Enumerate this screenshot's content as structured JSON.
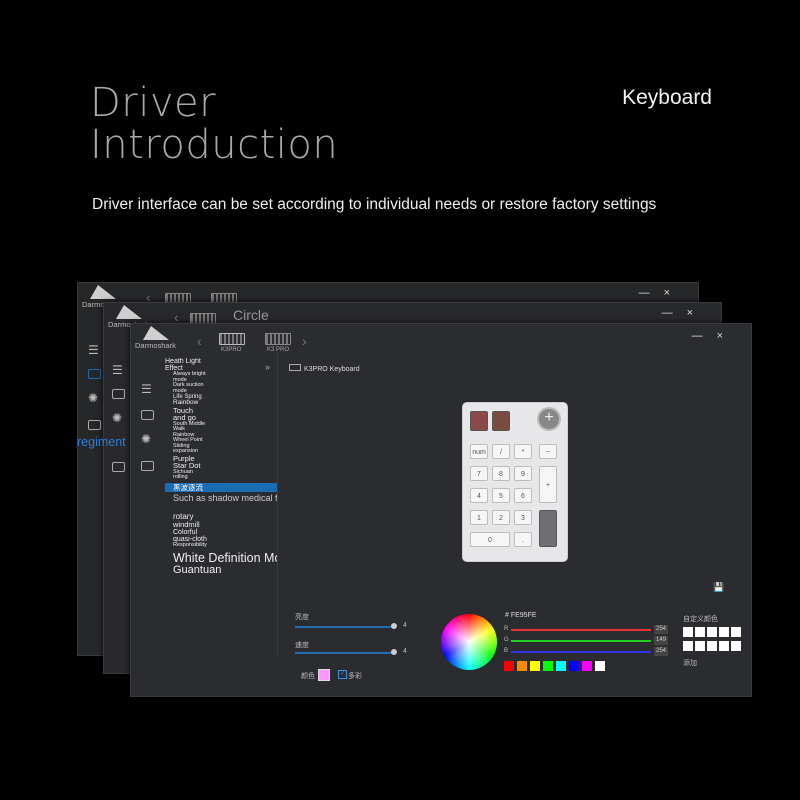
{
  "hero": {
    "title_line1": "Driver",
    "title_line2": "Introduction",
    "tag": "Keyboard",
    "subtitle": "Driver interface can be set according to individual needs or restore factory settings"
  },
  "colors": {
    "selection": "#1a6cb3",
    "slider": "#1e6db0",
    "background": "#000000"
  },
  "back_windows": {
    "w1_brand": "Darmoshark",
    "w2_brand": "Darmoshark",
    "w2_mode_title": "Circle",
    "w2_side_overlay": "regiment"
  },
  "window": {
    "brand": "Darmoshark",
    "minimize": "—",
    "close": "×",
    "devices": [
      "K3PRO",
      "K3 PRO"
    ],
    "panel_title": "K3PRO Keyboard",
    "light_list": [
      "Heath Light",
      "Effect",
      "Always bright",
      "mode",
      "Dark suction",
      "mode",
      "Life Spring",
      "Rainbow",
      "Touch",
      "and go",
      "South Middle",
      "Walk",
      "Rainbow",
      "Wheel Point",
      "Sliding",
      "expansion",
      "Purple",
      "Star Dot",
      "Sichuan",
      "rolling"
    ],
    "selected_item": "黑波逐流",
    "list_after": [
      "Such as shadow medical form",
      "rotary",
      "windmill",
      "Colorful",
      "quasi-cloth",
      "Responsibility",
      "White Definition Mode",
      "Guantuan"
    ],
    "sliders": [
      {
        "label": "亮度",
        "value": "4",
        "level": 0.99
      },
      {
        "label": "速度",
        "value": "4",
        "level": 0.99
      }
    ],
    "color_label": "颜色",
    "multicolor_label": "多彩",
    "hex": "# FE95FE",
    "rgb": [
      {
        "ch": "R",
        "val": "254",
        "color": "#e33"
      },
      {
        "ch": "G",
        "val": "149",
        "color": "#2c2"
      },
      {
        "ch": "B",
        "val": "254",
        "color": "#33e"
      }
    ],
    "swatches": [
      "#ff0000",
      "#ff8c00",
      "#ffff00",
      "#00ff00",
      "#00ffff",
      "#0000ff",
      "#ff00ff",
      "#ffffff"
    ],
    "custom_color_label": "自定义颜色",
    "add_label": "添加",
    "keys": [
      [
        "",
        "",
        "",
        ""
      ],
      [
        "num",
        "/",
        "*",
        "−"
      ],
      [
        "7",
        "8",
        "9",
        ""
      ],
      [
        "4",
        "5",
        "6",
        "+"
      ],
      [
        "1",
        "2",
        "3",
        ""
      ],
      [
        "0",
        "",
        ".",
        ""
      ]
    ]
  }
}
